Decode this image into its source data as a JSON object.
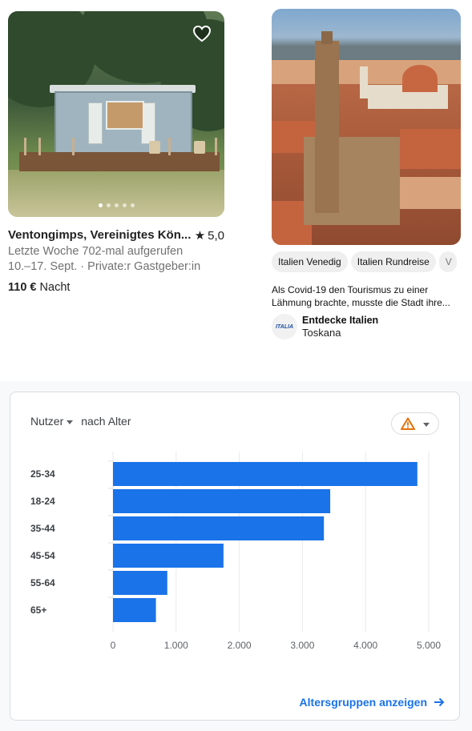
{
  "listing": {
    "title": "Ventongimps, Vereinigtes Kön...",
    "rating": "5,0",
    "views": "Letzte Woche 702-mal aufgerufen",
    "dates_host": "10.–17. Sept. · Private:r Gastgeber:in",
    "price": "110 €",
    "price_unit": "Nacht",
    "photo_count": 5,
    "active_photo": 1
  },
  "pin": {
    "chips": [
      "Italien Venedig",
      "Italien Rundreise",
      "V"
    ],
    "description": "Als Covid-19 den Tourismus zu einer Lähmung brachte, musste die Stadt ihre...",
    "author_name": "Entdecke Italien",
    "author_sub": "Toskana",
    "author_logo_text": "ITALIA"
  },
  "analytics": {
    "metric_label": "Nutzer",
    "dimension_label": "nach Alter",
    "footer_link": "Altersgruppen anzeigen",
    "bar_color": "#1a73e8",
    "warning_color": "#e8710a"
  },
  "chart_data": {
    "type": "bar",
    "orientation": "horizontal",
    "categories": [
      "25-34",
      "18-24",
      "35-44",
      "45-54",
      "55-64",
      "65+"
    ],
    "values": [
      4820,
      3440,
      3340,
      1750,
      860,
      680
    ],
    "xlim": [
      0,
      5000
    ],
    "xticks": [
      "0",
      "1.000",
      "2.000",
      "3.000",
      "4.000",
      "5.000"
    ],
    "grid": true,
    "title": "",
    "xlabel": "",
    "ylabel": ""
  }
}
